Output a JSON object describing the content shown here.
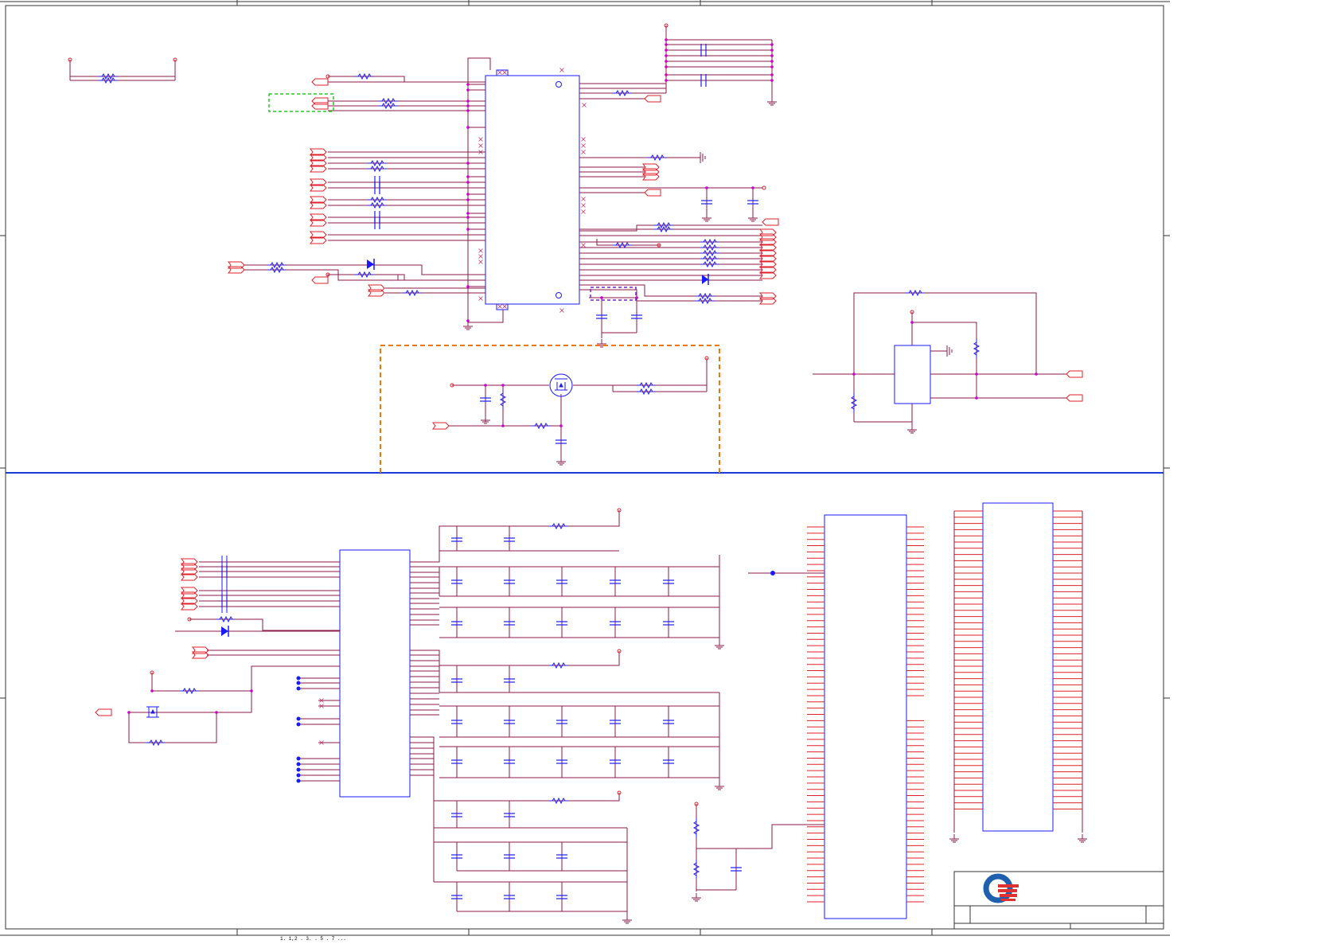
{
  "colors": {
    "wire": "#8b1a4a",
    "component": "#1a1aff",
    "port": "#e0202a",
    "junction": "#cc00cc",
    "frame": "#333333",
    "divider": "#1a3adb",
    "box_green": "#22cc22",
    "box_orange": "#ee7711",
    "box_purple": "#7722cc"
  },
  "icons": {
    "logo": "company-logo-icon",
    "ground": "ground-symbol-icon",
    "resistor": "resistor-symbol-icon",
    "capacitor": "capacitor-symbol-icon",
    "diode": "diode-symbol-icon",
    "mosfet": "mosfet-symbol-icon",
    "port": "port-flag-icon",
    "no_connect": "no-connect-mark-icon"
  },
  "footer": {
    "text": "1. 1,2 . 3. . 5 . 7 ..."
  }
}
